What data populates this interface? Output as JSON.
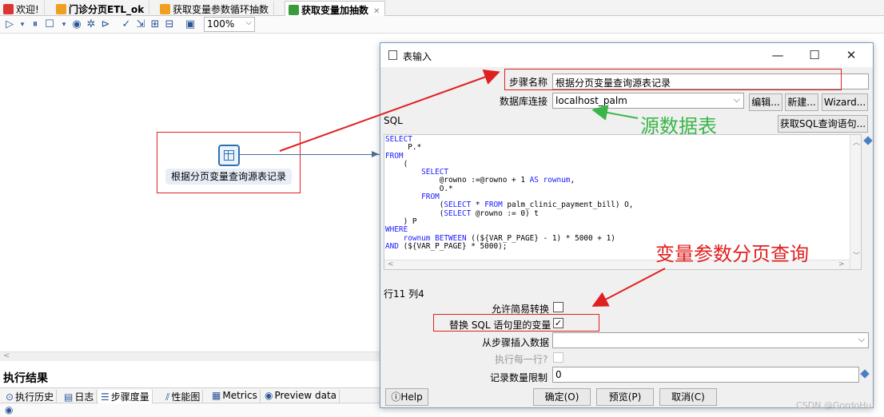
{
  "tabs": [
    {
      "label": "欢迎!",
      "icon": "welcome-icon",
      "active": false
    },
    {
      "label": "门诊分页ETL_ok",
      "icon": "job-icon",
      "active": false
    },
    {
      "label": "获取变量参数循环抽数",
      "icon": "job-icon",
      "active": false
    },
    {
      "label": "获取变量加抽数",
      "icon": "transformation-icon",
      "active": true
    }
  ],
  "toolbar": {
    "zoom_value": "100%"
  },
  "canvas": {
    "step_label": "根据分页变量查询源表记录"
  },
  "bottom_panel": {
    "title": "执行结果",
    "tabs": [
      "执行历史",
      "日志",
      "步骤度量",
      "性能图",
      "Metrics",
      "Preview data"
    ]
  },
  "dialog": {
    "title": "表输入",
    "controls": {
      "minimize": "—",
      "maximize": "☐",
      "close": "✕"
    },
    "step_name_label": "步骤名称",
    "step_name_value": "根据分页变量查询源表记录",
    "db_conn_label": "数据库连接",
    "db_conn_value": "localhost_palm",
    "edit_button": "编辑...",
    "new_button": "新建...",
    "wizard_button": "Wizard...",
    "sql_label": "SQL",
    "get_sql_button": "获取SQL查询语句...",
    "sql_lines": [
      {
        "kw": "SELECT",
        "rest": ""
      },
      {
        "kw": "",
        "rest": "     P.*"
      },
      {
        "kw": "FROM",
        "rest": ""
      },
      {
        "kw": "",
        "rest": "    ("
      },
      {
        "kw": "        SELECT",
        "rest": ""
      },
      {
        "kw": "",
        "rest": "            @rowno :=@rowno + 1 "
      },
      {
        "kw": "",
        "rest": "            O.*"
      },
      {
        "kw": "        FROM",
        "rest": ""
      },
      {
        "kw": "",
        "rest": "            (SELECT * FROM palm_clinic_payment_bill) O,"
      },
      {
        "kw": "",
        "rest": "            (SELECT @rowno := 0) t"
      },
      {
        "kw": "",
        "rest": "    ) P"
      },
      {
        "kw": "WHERE",
        "rest": ""
      },
      {
        "kw": "",
        "rest": "    rownum BETWEEN ((${VAR_P_PAGE} - 1) * 5000 + 1)"
      },
      {
        "kw": "",
        "rest": "AND (${VAR_P_PAGE} * 5000);"
      }
    ],
    "line_col": "行11 列4",
    "lazy_conversion_label": "允许简易转换",
    "replace_vars_label": "替换 SQL 语句里的变量",
    "insert_from_step_label": "从步骤插入数据",
    "execute_each_row_label": "执行每一行?",
    "limit_label": "记录数量限制",
    "limit_value": "0",
    "help_button": "Help",
    "ok_button": "确定(O)",
    "preview_button": "预览(P)",
    "cancel_button": "取消(C)"
  },
  "annotations": {
    "source_table": "源数据表",
    "paging_query": "变量参数分页查询"
  },
  "watermark": "CSDN @GordoHu",
  "colors": {
    "annotation_red": "#e02020",
    "annotation_green": "#3bb54a",
    "sql_keyword": "#1a1aff"
  }
}
